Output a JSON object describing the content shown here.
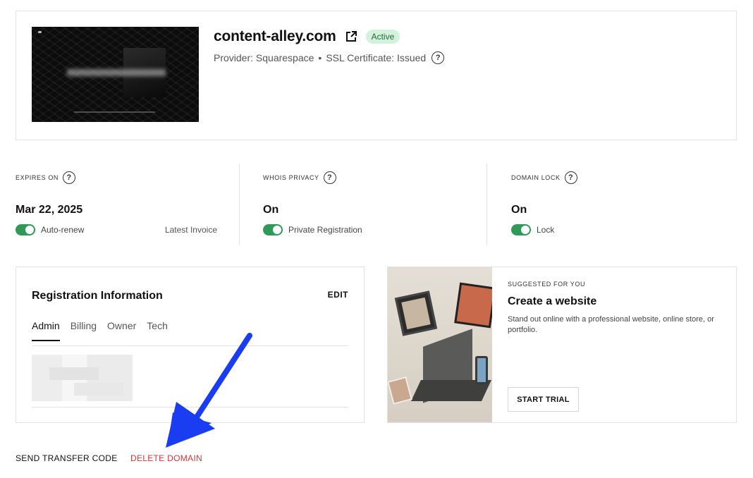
{
  "domain": {
    "name": "content-alley.com",
    "status": "Active",
    "provider_text": "Provider: Squarespace",
    "separator": "•",
    "ssl_text": "SSL Certificate: Issued"
  },
  "info": {
    "expires": {
      "label": "EXPIRES ON",
      "value": "Mar 22, 2025",
      "toggle_label": "Auto-renew",
      "link": "Latest Invoice"
    },
    "whois": {
      "label": "WHOIS PRIVACY",
      "value": "On",
      "toggle_label": "Private Registration"
    },
    "lock": {
      "label": "DOMAIN LOCK",
      "value": "On",
      "toggle_label": "Lock"
    }
  },
  "registration": {
    "title": "Registration Information",
    "edit_label": "EDIT",
    "tabs": [
      "Admin",
      "Billing",
      "Owner",
      "Tech"
    ],
    "active_tab": "Admin"
  },
  "suggested": {
    "label": "SUGGESTED FOR YOU",
    "title": "Create a website",
    "description": "Stand out online with a professional website, online store, or portfolio.",
    "cta": "START TRIAL"
  },
  "actions": {
    "send_transfer": "SEND TRANSFER CODE",
    "delete_domain": "DELETE DOMAIN"
  },
  "colors": {
    "toggle_on": "#2f9a57",
    "delete": "#d0393a",
    "badge_bg": "#d4f1dd",
    "arrow": "#1a3df2"
  },
  "icons": {
    "external": "external-link-icon",
    "help": "question-circle-icon"
  }
}
